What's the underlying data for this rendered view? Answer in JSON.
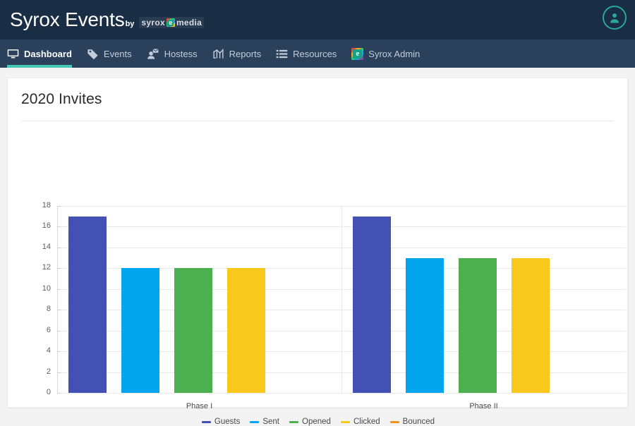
{
  "header": {
    "brand_title": "Syrox Events",
    "brand_by": "by",
    "logo_left": "syrox",
    "logo_mark": "e",
    "logo_right": "media",
    "avatar_label": "user-account"
  },
  "nav": {
    "items": [
      {
        "label": "Dashboard",
        "icon": "monitor-icon",
        "active": true
      },
      {
        "label": "Events",
        "icon": "tag-icon",
        "active": false
      },
      {
        "label": "Hostess",
        "icon": "user-envelope-icon",
        "active": false
      },
      {
        "label": "Reports",
        "icon": "chart-line-icon",
        "active": false
      },
      {
        "label": "Resources",
        "icon": "list-icon",
        "active": false
      },
      {
        "label": "Syrox Admin",
        "icon": "syrox-logo-icon",
        "active": false
      }
    ]
  },
  "card": {
    "title": "2020 Invites"
  },
  "colors": {
    "accent_teal": "#45c9b4",
    "header_dark": "#192d45",
    "nav_dark": "#2b405a",
    "guests": "#4350b4",
    "sent": "#04a5ef",
    "opened": "#4caf50",
    "clicked": "#f8c81c",
    "bounced": "#f39318"
  },
  "chart_data": {
    "type": "bar",
    "title": "2020 Invites",
    "xlabel": "",
    "ylabel": "",
    "categories": [
      "Phase I",
      "Phase II"
    ],
    "ylim": [
      0,
      18
    ],
    "yticks": [
      0,
      2,
      4,
      6,
      8,
      10,
      12,
      14,
      16,
      18
    ],
    "grid": true,
    "legend_position": "bottom",
    "series": [
      {
        "name": "Guests",
        "color": "#4350b4",
        "values": [
          17,
          17
        ]
      },
      {
        "name": "Sent",
        "color": "#04a5ef",
        "values": [
          12,
          13
        ]
      },
      {
        "name": "Opened",
        "color": "#4caf50",
        "values": [
          12,
          13
        ]
      },
      {
        "name": "Clicked",
        "color": "#f8c81c",
        "values": [
          12,
          13
        ]
      },
      {
        "name": "Bounced",
        "color": "#f39318",
        "values": [
          0,
          0
        ]
      }
    ]
  }
}
